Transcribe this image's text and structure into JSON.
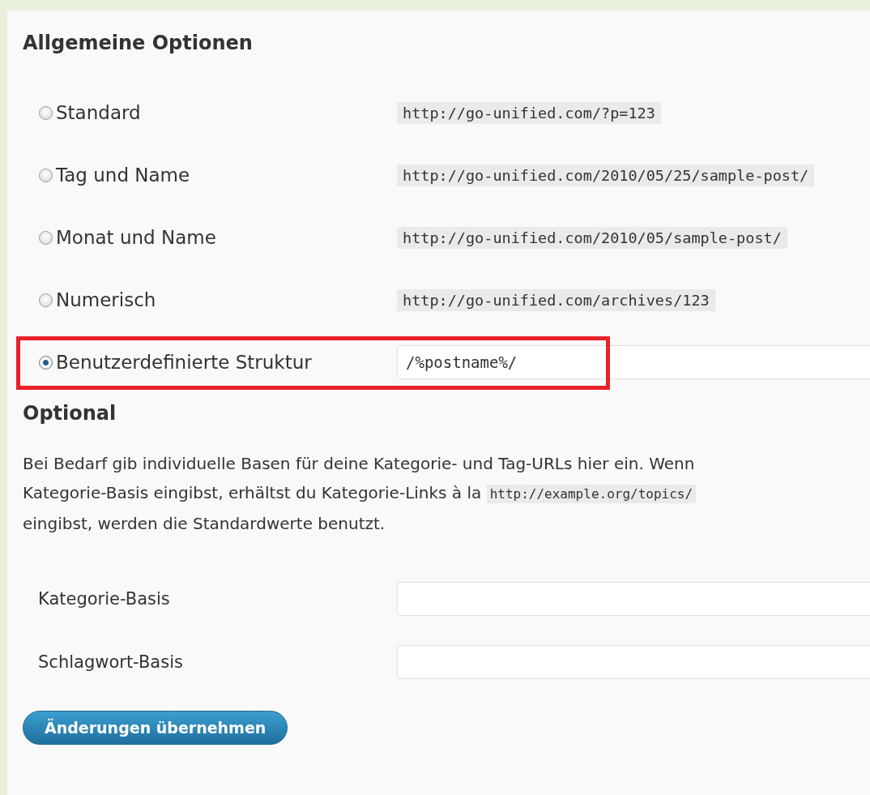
{
  "heading": "Allgemeine Optionen",
  "options": [
    {
      "kind": "example",
      "label": "Standard",
      "example": "http://go-unified.com/?p=123",
      "selected": false
    },
    {
      "kind": "example",
      "label": "Tag und Name",
      "example": "http://go-unified.com/2010/05/25/sample-post/",
      "selected": false
    },
    {
      "kind": "example",
      "label": "Monat und Name",
      "example": "http://go-unified.com/2010/05/sample-post/",
      "selected": false
    },
    {
      "kind": "example",
      "label": "Numerisch",
      "example": "http://go-unified.com/archives/123",
      "selected": false
    },
    {
      "kind": "custom",
      "label": "Benutzerdefinierte Struktur",
      "value": "/%postname%/",
      "selected": true,
      "highlighted": true
    }
  ],
  "optional": {
    "heading": "Optional",
    "text_before": "Bei Bedarf gib individuelle Basen für deine Kategorie- und Tag-URLs hier ein. Wenn\nKategorie-Basis eingibst, erhältst du Kategorie-Links à la ",
    "code": "http://example.org/topics/",
    "text_after": "\neingibst, werden die Standardwerte benutzt."
  },
  "fields": [
    {
      "label": "Kategorie-Basis"
    },
    {
      "label": "Schlagwort-Basis"
    }
  ],
  "button": "Änderungen übernehmen"
}
